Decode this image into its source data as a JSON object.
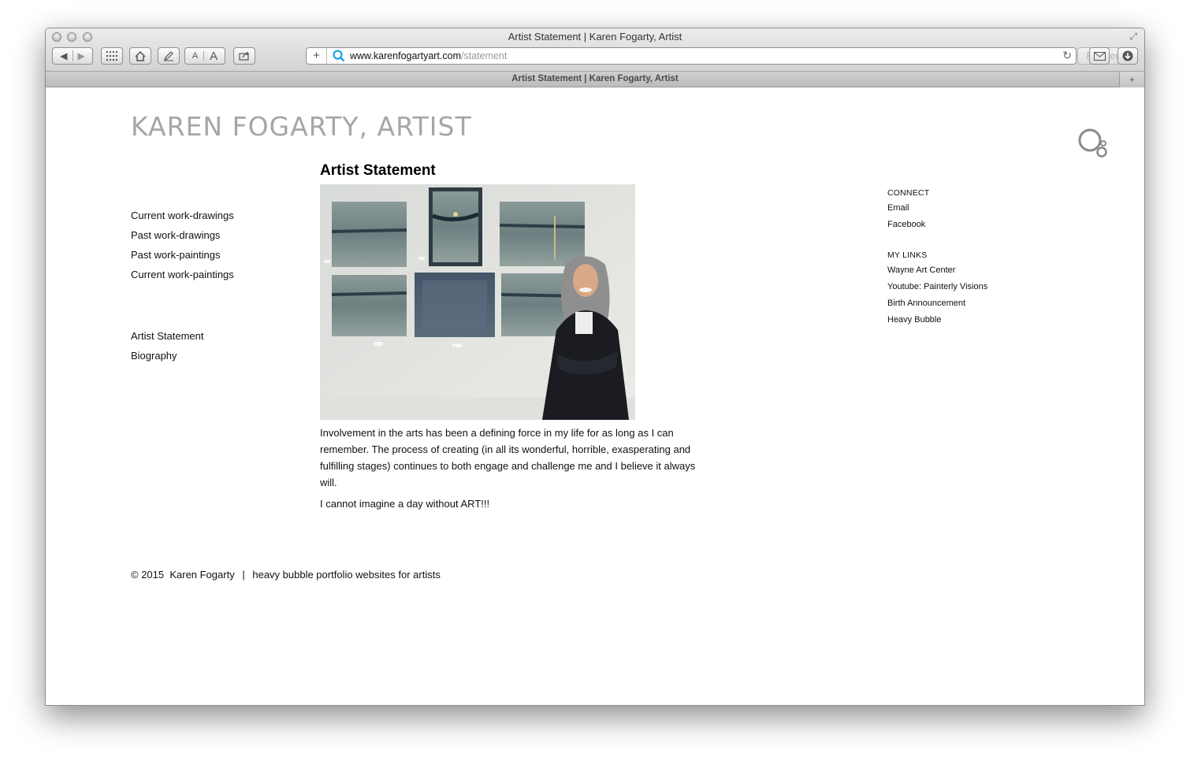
{
  "window": {
    "title": "Artist Statement | Karen Fogarty, Artist",
    "url_host": "www.karenfogartyart.com",
    "url_path": "/statement",
    "reader_label": "Reader",
    "tab_title": "Artist Statement | Karen Fogarty, Artist",
    "toolbar_text_small": "A",
    "toolbar_text_large": "A"
  },
  "site": {
    "title": "KAREN FOGARTY, ARTIST"
  },
  "nav": {
    "work": [
      {
        "label": "Current work-drawings"
      },
      {
        "label": "Past work-drawings"
      },
      {
        "label": "Past work-paintings"
      },
      {
        "label": "Current work-paintings"
      }
    ],
    "info": [
      {
        "label": "Artist Statement"
      },
      {
        "label": "Biography"
      }
    ]
  },
  "main": {
    "heading": "Artist Statement",
    "paragraph1": "Involvement in the arts has been a defining force in my life for as long as I can remember. The process of creating (in all its wonderful, horrible, exasperating and fulfilling stages) continues to both engage and challenge me and I believe it always will.",
    "paragraph2": "I cannot imagine a day without ART!!!"
  },
  "sidebar": {
    "connect_heading": "CONNECT",
    "connect_links": [
      {
        "label": "Email"
      },
      {
        "label": "Facebook"
      }
    ],
    "links_heading": "MY LINKS",
    "my_links": [
      {
        "label": "Wayne Art Center"
      },
      {
        "label": "Youtube: Painterly Visions"
      },
      {
        "label": "Birth Announcement"
      },
      {
        "label": "Heavy Bubble"
      }
    ]
  },
  "footer": {
    "copyright": "© 2015  Karen Fogarty",
    "separator": "|",
    "credit": "heavy bubble portfolio websites for artists"
  },
  "colors": {
    "accent_search": "#1da1e6",
    "site_title": "#a6a6a6"
  }
}
